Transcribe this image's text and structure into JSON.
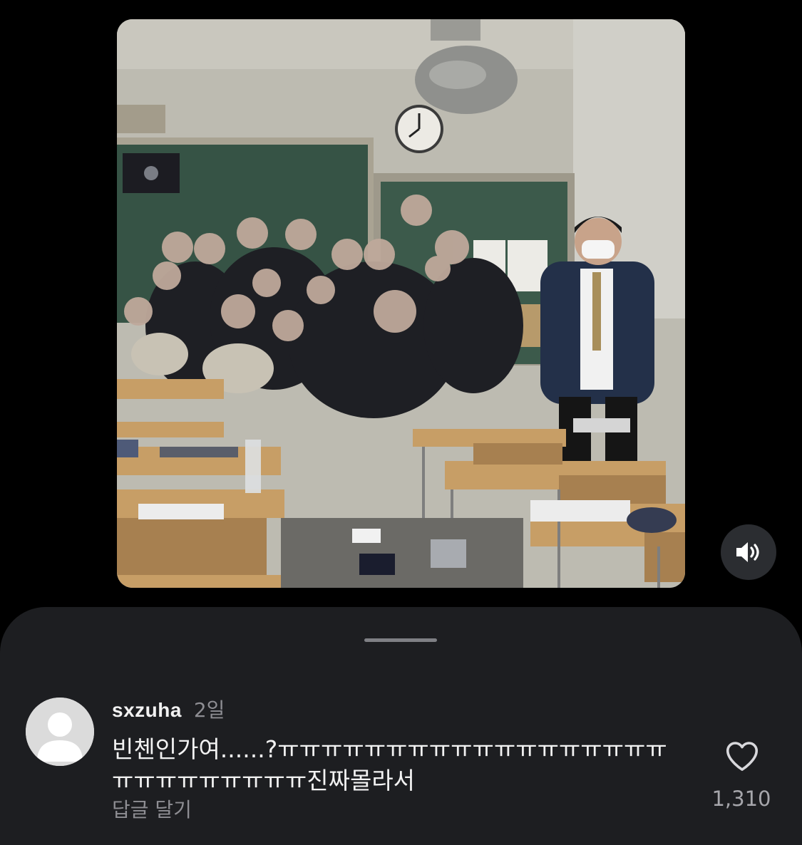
{
  "media": {
    "photo_icon": "classroom-photo",
    "mute_icon": "speaker-muted-icon"
  },
  "comment": {
    "username": "sxzuha",
    "time": "2일",
    "text": "빈첸인가여......?ㅠㅠㅠㅠㅠㅠㅠㅠㅠㅠㅠㅠㅠㅠㅠㅠㅠㅠㅠㅠㅠㅠㅠㅠㅠㅠㅠ진짜몰라서",
    "reply_label": "답글 달기",
    "like_count": "1,310",
    "like_icon": "heart-outline-icon"
  },
  "colors": {
    "background": "#000000",
    "sheet": "#1d1e21",
    "primary_text": "#f2f2f2",
    "secondary_text": "#8e8e93"
  }
}
